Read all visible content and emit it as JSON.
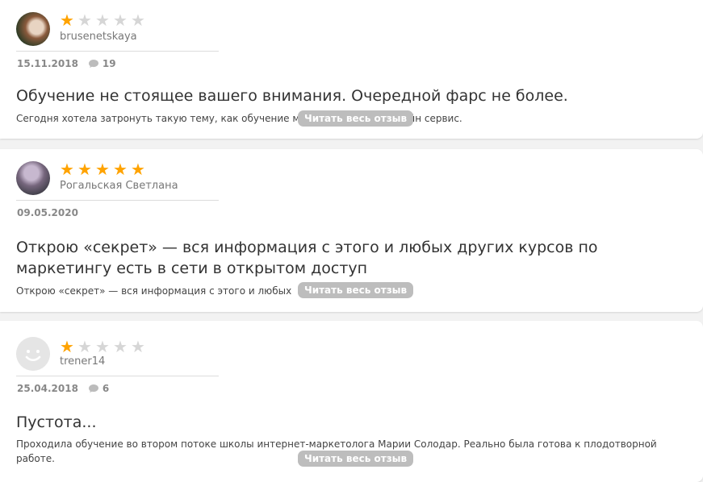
{
  "reviews": [
    {
      "author": "brusenetskaya",
      "rating": 1,
      "date": "15.11.2018",
      "comments": "19",
      "title": "Обучение не стоящее вашего внимания. Очередной фарс не более.",
      "snippet": "Сегодня хотела затронуть такую тему, как обучение м",
      "snippet_tail": "йн сервис.",
      "read_more": "Читать весь отзыв"
    },
    {
      "author": "Рогальская Светлана",
      "rating": 5,
      "date": "09.05.2020",
      "comments": "",
      "title": "Открою «секрет» — вся информация с этого и любых других курсов по маркетингу есть в сети в открытом доступ",
      "snippet": "Открою «секрет» — вся информация с этого и любых",
      "snippet_tail": "",
      "read_more": "Читать весь отзыв"
    },
    {
      "author": "trener14",
      "rating": 1,
      "date": "25.04.2018",
      "comments": "6",
      "title": "Пустота...",
      "snippet": "Проходила обучение во втором потоке школы интернет-маркетолога Марии Солодар. Реально была готова к плодотворной работе.",
      "snippet_tail": "",
      "read_more": "Читать весь отзыв"
    }
  ],
  "colors": {
    "star_active": "#ffa300",
    "star_inactive": "#d6d6d6",
    "button_bg": "#bdbdbd"
  },
  "icons": {
    "comment": "speech-bubble-icon",
    "star": "star-icon",
    "default_avatar": "smiley-face-icon"
  }
}
